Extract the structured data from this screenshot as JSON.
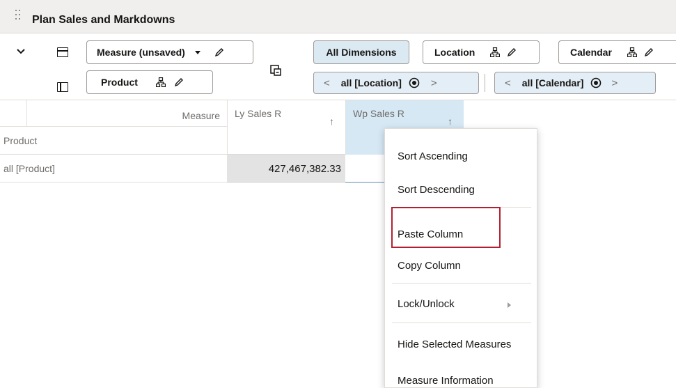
{
  "title": "Plan Sales and Markdowns",
  "layout": {
    "measure_chip": "Measure (unsaved)",
    "product_chip": "Product",
    "all_dimensions": "All Dimensions",
    "location_chip": "Location",
    "calendar_chip": "Calendar",
    "location_value": "all [Location]",
    "calendar_value": "all [Calendar]",
    "prev_arrow": "<",
    "next_arrow": ">"
  },
  "grid": {
    "measure_label": "Measure",
    "product_header": "Product",
    "columns": [
      "Ly Sales R",
      "Wp Sales R"
    ],
    "sort_glyph": "↑",
    "rows": [
      {
        "label": "all [Product]",
        "values": [
          "427,467,382.33",
          ""
        ]
      }
    ]
  },
  "context_menu": {
    "items": [
      "Sort Ascending",
      "Sort Descending",
      "Paste Column",
      "Copy Column",
      "Lock/Unlock",
      "Hide Selected Measures",
      "Measure Information"
    ],
    "highlighted": "Paste Column"
  },
  "colors": {
    "header_bg": "#f1efed",
    "selected_column": "#d6e8f4",
    "chip_active": "#dbe9f3",
    "highlight_border": "#b22030"
  }
}
